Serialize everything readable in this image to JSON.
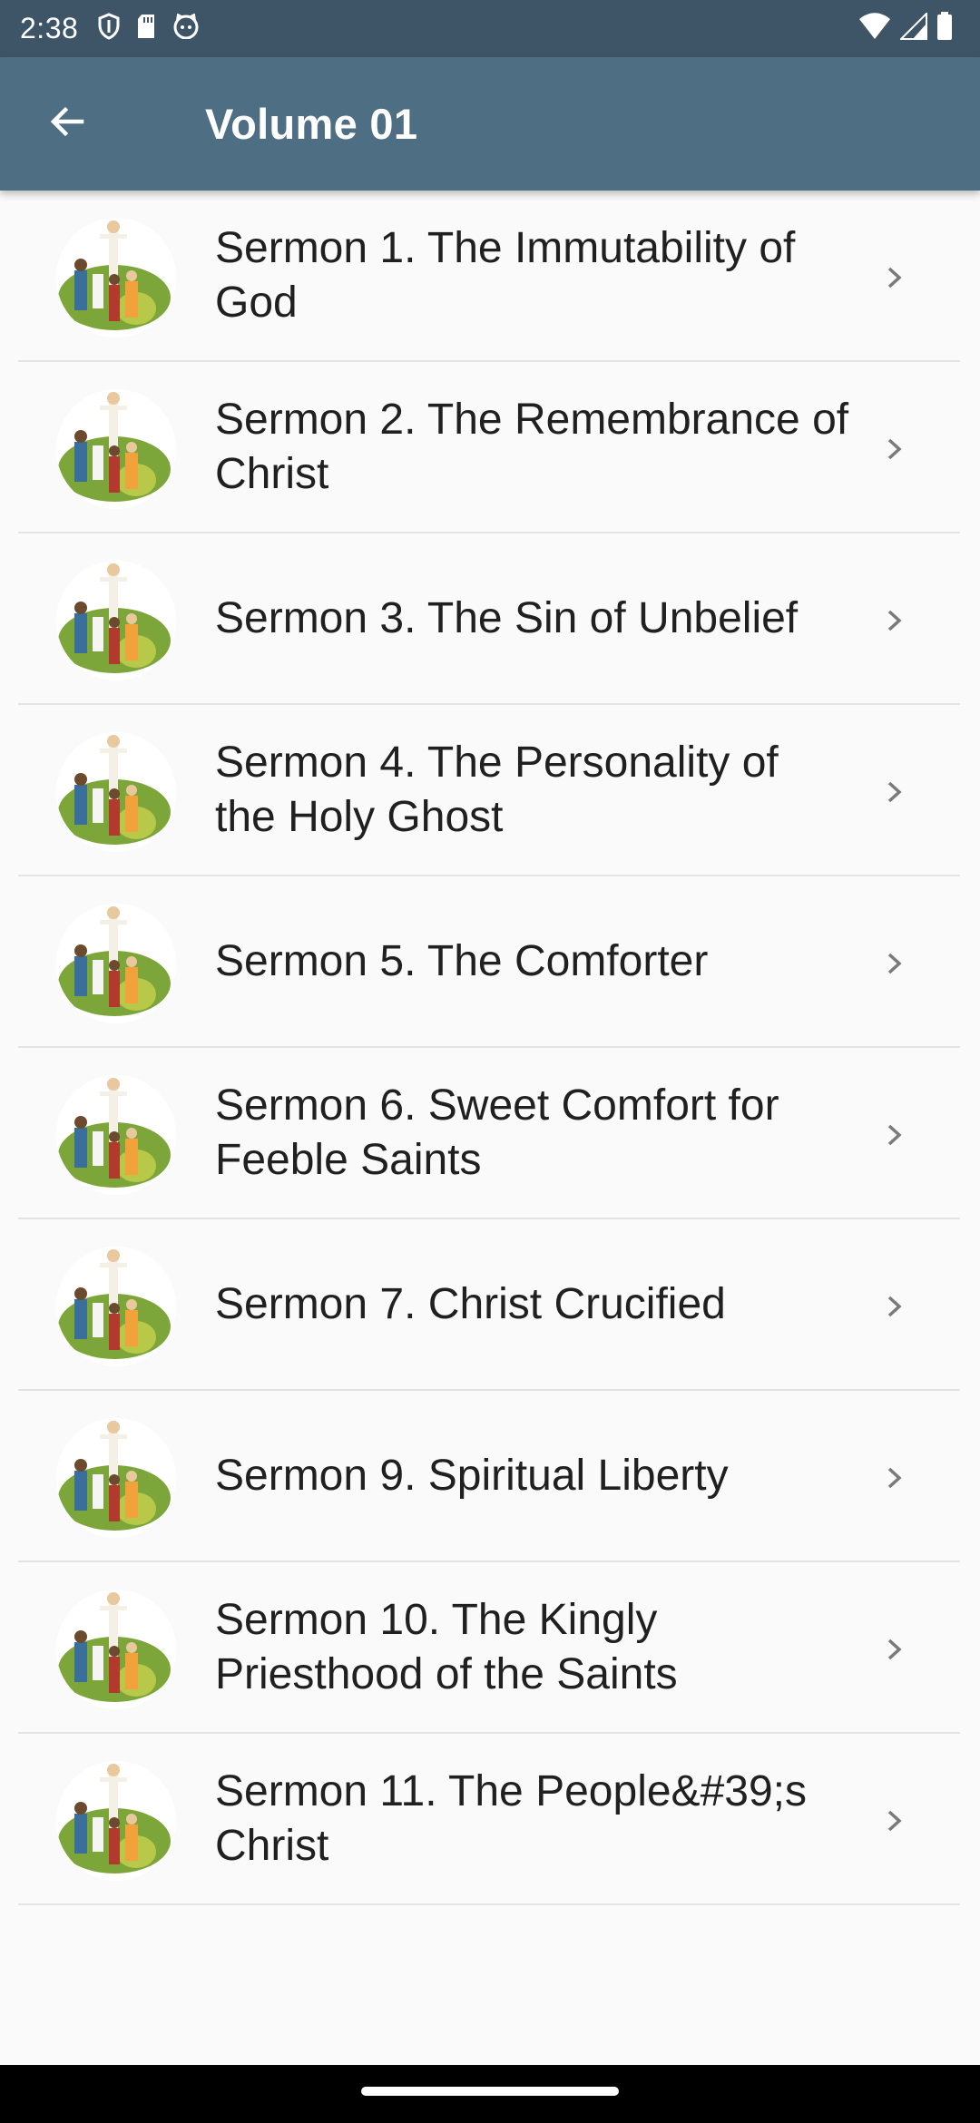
{
  "status_bar": {
    "time": "2:38",
    "left_icons": [
      "shield-icon",
      "sd-card-icon",
      "cat-face-icon"
    ],
    "right_icons": [
      "wifi-icon",
      "cellular-signal-icon",
      "battery-icon"
    ]
  },
  "app_bar": {
    "back_icon": "arrow-back-icon",
    "title": "Volume 01"
  },
  "sermons": [
    {
      "label": "Sermon 1. The Immutability of God"
    },
    {
      "label": "Sermon 2. The Remembrance of Christ"
    },
    {
      "label": "Sermon 3. The Sin of Unbelief"
    },
    {
      "label": "Sermon 4. The Personality of the Holy Ghost"
    },
    {
      "label": "Sermon 5. The Comforter"
    },
    {
      "label": "Sermon 6. Sweet Comfort for Feeble Saints"
    },
    {
      "label": "Sermon 7. Christ Crucified"
    },
    {
      "label": "Sermon 9. Spiritual Liberty"
    },
    {
      "label": "Sermon 10. The Kingly Priesthood of the Saints"
    },
    {
      "label": "Sermon 11. The People&#39;s Christ"
    }
  ],
  "colors": {
    "status_bar": "#3e5568",
    "app_bar": "#4e6e84",
    "background": "#fafafa",
    "divider": "#e3e3e3",
    "chevron": "#7a7a7a"
  }
}
